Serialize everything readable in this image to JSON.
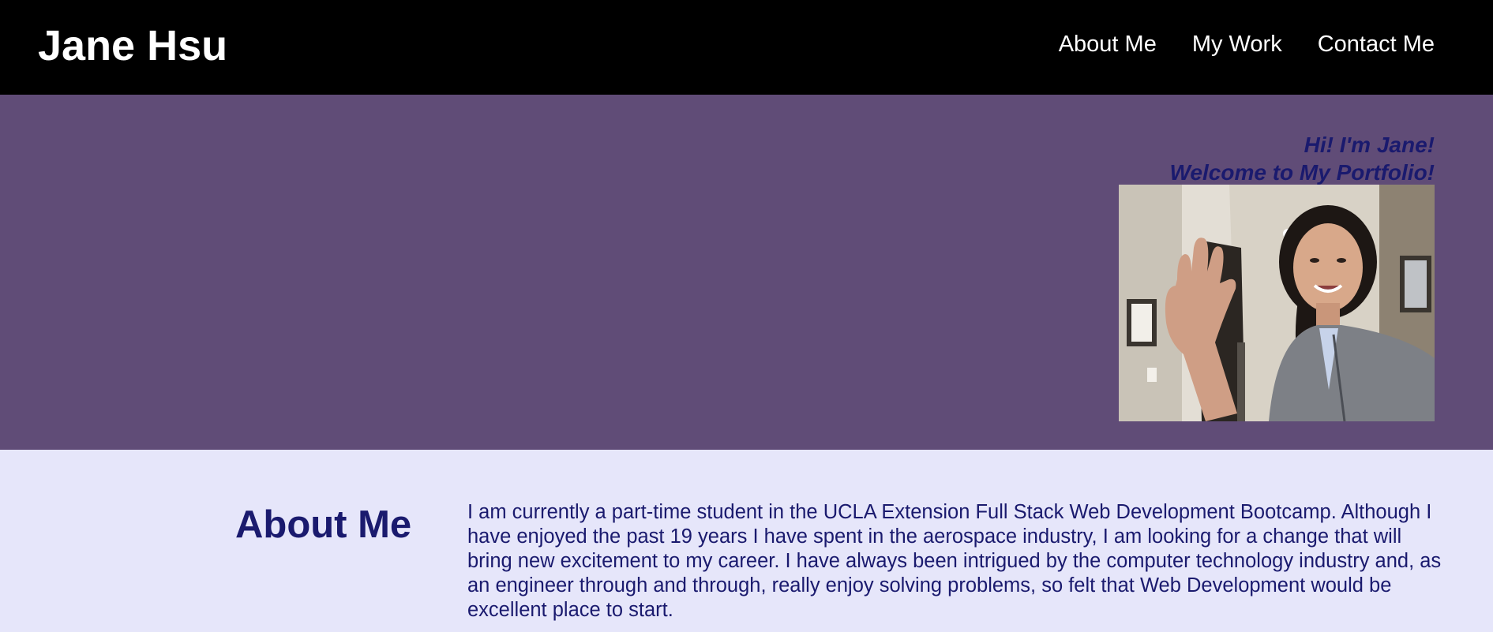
{
  "header": {
    "site_name": "Jane Hsu",
    "nav": [
      {
        "label": "About Me"
      },
      {
        "label": "My Work"
      },
      {
        "label": "Contact Me"
      }
    ]
  },
  "hero": {
    "greeting_line1": "Hi! I'm Jane!",
    "greeting_line2": "Welcome to My Portfolio!",
    "photo_alt": "Jane waving hello"
  },
  "about": {
    "heading": "About Me",
    "text": "I am currently a part-time student in the UCLA Extension Full Stack Web Development Bootcamp. Although I have enjoyed the past 19 years I have spent in the aerospace industry, I am looking for a change that will bring new excitement to my career. I have always been intrigued by the computer technology industry and, as an engineer through and through, really enjoy solving problems, so felt that Web Development would be excellent place to start."
  },
  "colors": {
    "header_bg": "#000000",
    "hero_bg": "#604c77",
    "about_bg": "#e6e6fa",
    "accent_text": "#1a1a6e"
  }
}
